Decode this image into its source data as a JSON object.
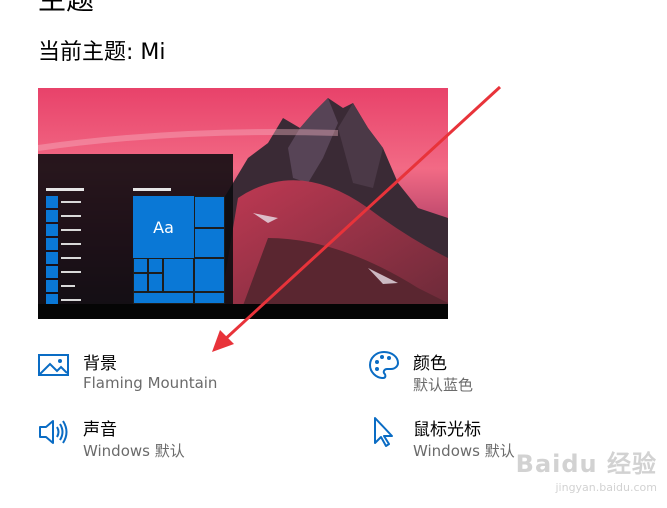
{
  "header": {
    "section_title_partial": "主题",
    "current_theme": "当前主题: Mi"
  },
  "preview": {
    "tile_text": "Aa",
    "accent_color": "#0a78d6"
  },
  "settings": [
    {
      "id": "background",
      "icon": "image-icon",
      "title": "背景",
      "subtitle": "Flaming Mountain"
    },
    {
      "id": "color",
      "icon": "palette-icon",
      "title": "颜色",
      "subtitle": "默认蓝色"
    },
    {
      "id": "sound",
      "icon": "speaker-icon",
      "title": "声音",
      "subtitle": "Windows 默认"
    },
    {
      "id": "cursor",
      "icon": "cursor-icon",
      "title": "鼠标光标",
      "subtitle": "Windows 默认"
    }
  ],
  "annotation": {
    "arrow_color": "#e8333a"
  },
  "watermark": {
    "main": "Baidu 经验",
    "sub": "jingyan.baidu.com"
  }
}
